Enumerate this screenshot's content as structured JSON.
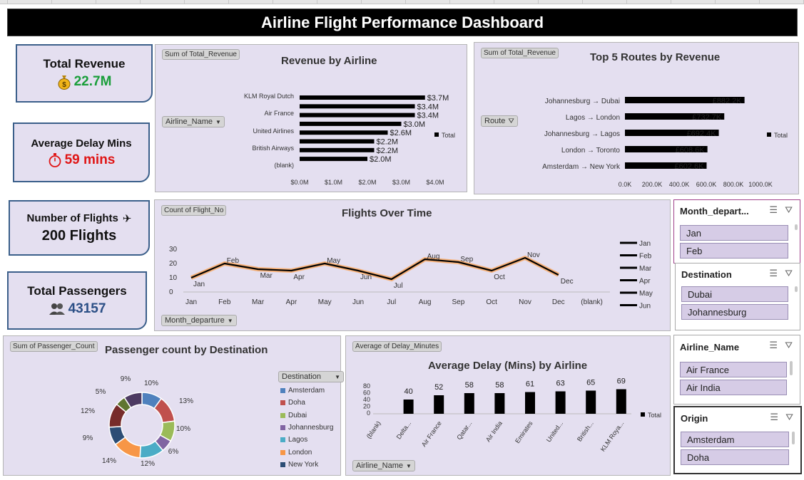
{
  "title": "Airline Flight Performance Dashboard",
  "kpis": {
    "revenue": {
      "label": "Total Revenue",
      "icon": "money-bag-icon",
      "value": "22.7M",
      "color": "#1a9e3a"
    },
    "delay": {
      "label": "Average Delay Mins",
      "icon": "stopwatch-icon",
      "value": "59 mins",
      "color": "#e01515"
    },
    "flights": {
      "label": "Number of Flights",
      "icon": "airplane-icon",
      "value": "200 Flights"
    },
    "passengers": {
      "label": "Total Passengers",
      "icon": "people-icon",
      "value": "43157",
      "color": "#2b4f86"
    }
  },
  "revenue_chart": {
    "field_tag": "Sum of Total_Revenue",
    "title": "Revenue by Airline",
    "filter_label": "Airline_Name",
    "legend": "Total",
    "y_labels": [
      "KLM Royal Dutch",
      "Air France",
      "United Airlines",
      "British Airways",
      "(blank)"
    ],
    "bar_labels": [
      "$3.7M",
      "$3.4M",
      "$3.4M",
      "$3.0M",
      "$2.6M",
      "$2.2M",
      "$2.2M",
      "$2.0M"
    ],
    "x_ticks": [
      "$0.0M",
      "$1.0M",
      "$2.0M",
      "$3.0M",
      "$4.0M"
    ]
  },
  "routes_chart": {
    "field_tag": "Sum of Total_Revenue",
    "title": "Top 5 Routes by Revenue",
    "filter_label": "Route",
    "legend": "Total",
    "x_ticks": [
      "0.0K",
      "200.0K",
      "400.0K",
      "600.0K",
      "800.0K",
      "1000.0K"
    ]
  },
  "flights_chart": {
    "field_tag": "Count of Flight_No",
    "title": "Flights Over Time",
    "filter_label": "Month_departure",
    "y_ticks": [
      "30",
      "20",
      "10",
      "0"
    ],
    "x_labels": [
      "Jan",
      "Feb",
      "Mar",
      "Apr",
      "May",
      "Jun",
      "Jul",
      "Aug",
      "Sep",
      "Oct",
      "Nov",
      "Dec",
      "(blank)"
    ],
    "legend": [
      "Jan",
      "Feb",
      "Mar",
      "Apr",
      "May",
      "Jun"
    ]
  },
  "passenger_chart": {
    "field_tag": "Sum of Passenger_Count",
    "title": "Passenger count by Destination",
    "filter_label": "Destination",
    "legend": [
      {
        "name": "Amsterdam",
        "color": "#4f81bd"
      },
      {
        "name": "Doha",
        "color": "#c0504d"
      },
      {
        "name": "Dubai",
        "color": "#9bbb59"
      },
      {
        "name": "Johannesburg",
        "color": "#8064a2"
      },
      {
        "name": "Lagos",
        "color": "#4bacc6"
      },
      {
        "name": "London",
        "color": "#f79646"
      },
      {
        "name": "New York",
        "color": "#2c4d75"
      }
    ]
  },
  "delay_chart": {
    "field_tag": "Average of Delay_Minutes",
    "title": "Average Delay (Mins) by Airline",
    "filter_label": "Airline_Name",
    "legend": "Total",
    "y_ticks": [
      "80",
      "60",
      "40",
      "20",
      "0"
    ]
  },
  "chart_data": [
    {
      "type": "bar",
      "title": "Revenue by Airline",
      "orientation": "horizontal",
      "series": [
        {
          "name": "Total",
          "values": [
            3.7,
            3.4,
            3.4,
            3.0,
            2.6,
            2.2,
            2.2,
            2.0
          ]
        }
      ],
      "xlim": [
        0,
        4.0
      ]
    },
    {
      "type": "bar",
      "title": "Top 5 Routes by Revenue",
      "orientation": "horizontal",
      "categories": [
        "Johannesburg → Dubai",
        "Lagos → London",
        "Johannesburg → Lagos",
        "London → Toronto",
        "Amsterdam → New York"
      ],
      "value_labels": [
        "£882.2K",
        "£732.7K",
        "£692.4K",
        "£608.6K",
        "£602.6K"
      ],
      "series": [
        {
          "name": "Total",
          "values": [
            882.2,
            732.7,
            692.4,
            608.6,
            602.6
          ]
        }
      ],
      "xlim": [
        0,
        1000
      ]
    },
    {
      "type": "line",
      "title": "Flights Over Time",
      "categories": [
        "Jan",
        "Feb",
        "Mar",
        "Apr",
        "May",
        "Jun",
        "Jul",
        "Aug",
        "Sep",
        "Oct",
        "Nov",
        "Dec"
      ],
      "values": [
        10,
        20,
        16,
        15,
        20,
        15,
        9,
        23,
        21,
        15,
        24,
        12
      ],
      "ylim": [
        0,
        30
      ]
    },
    {
      "type": "pie",
      "title": "Passenger count by Destination",
      "slice_labels": [
        "10%",
        "13%",
        "10%",
        "6%",
        "12%",
        "14%",
        "9%",
        "12%",
        "5%",
        "9%"
      ],
      "values": [
        10,
        13,
        10,
        6,
        12,
        14,
        9,
        12,
        5,
        9
      ],
      "colors": [
        "#4f81bd",
        "#c0504d",
        "#9bbb59",
        "#8064a2",
        "#4bacc6",
        "#f79646",
        "#2c4d75",
        "#772c2a",
        "#5f7530",
        "#4d3b62"
      ]
    },
    {
      "type": "bar",
      "title": "Average Delay (Mins) by Airline",
      "categories": [
        "(blank)",
        "Delta...",
        "Air France",
        "Qatar...",
        "Air India",
        "Emirates",
        "United...",
        "British...",
        "KLM Roya..."
      ],
      "series": [
        {
          "name": "Total",
          "values": [
            null,
            40,
            52,
            58,
            58,
            61,
            63,
            65,
            69
          ]
        }
      ],
      "ylim": [
        0,
        80
      ]
    }
  ],
  "slicers": {
    "month": {
      "header": "Month_depart...",
      "items": [
        "Jan",
        "Feb"
      ]
    },
    "destination": {
      "header": "Destination",
      "items": [
        "Dubai",
        "Johannesburg"
      ]
    },
    "airline": {
      "header": "Airline_Name",
      "items": [
        "Air France",
        "Air India"
      ]
    },
    "origin": {
      "header": "Origin",
      "items": [
        "Amsterdam",
        "Doha"
      ]
    }
  }
}
